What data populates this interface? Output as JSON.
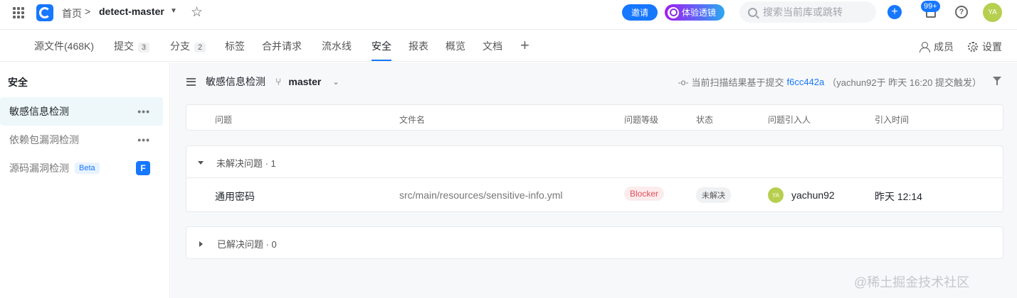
{
  "header": {
    "home": "首页",
    "separator": ">",
    "repo": "detect-master",
    "invite": "邀请",
    "trial": "体验透镜",
    "search_placeholder": "搜索当前库或跳转",
    "notifications_badge": "99+",
    "avatar_initials": "YA",
    "help": "?"
  },
  "tabs": [
    {
      "label": "源文件(468K)"
    },
    {
      "label": "提交",
      "count": "3"
    },
    {
      "label": "分支",
      "count": "2"
    },
    {
      "label": "标签"
    },
    {
      "label": "合并请求"
    },
    {
      "label": "流水线"
    },
    {
      "label": "安全"
    },
    {
      "label": "报表"
    },
    {
      "label": "概览"
    },
    {
      "label": "文档"
    }
  ],
  "tab_actions": {
    "members": "成员",
    "settings": "设置",
    "add": "+"
  },
  "sidebar": {
    "title": "安全",
    "items": [
      {
        "label": "敏感信息检测",
        "more": "•••"
      },
      {
        "label": "依赖包漏洞检测",
        "more": "•••"
      },
      {
        "label": "源码漏洞检测",
        "badge": "Beta",
        "app_icon": "F"
      }
    ]
  },
  "main": {
    "title": "敏感信息检测",
    "branch": "master",
    "scan_prefix": "当前扫描结果基于提交",
    "commit": "f6cc442a",
    "scan_suffix": "（yachun92于 昨天 16:20 提交触发）"
  },
  "table": {
    "columns": [
      "问题",
      "文件名",
      "问题等级",
      "状态",
      "问题引入人",
      "引入时间"
    ],
    "unresolved_label": "未解决问题 · 1",
    "resolved_label": "已解决问题 · 0",
    "rows": [
      {
        "issue": "通用密码",
        "file": "src/main/resources/sensitive-info.yml",
        "level": "Blocker",
        "status": "未解决",
        "author_initials": "YA",
        "author": "yachun92",
        "time": "昨天 12:14"
      }
    ]
  },
  "watermark": "@稀土掘金技术社区"
}
